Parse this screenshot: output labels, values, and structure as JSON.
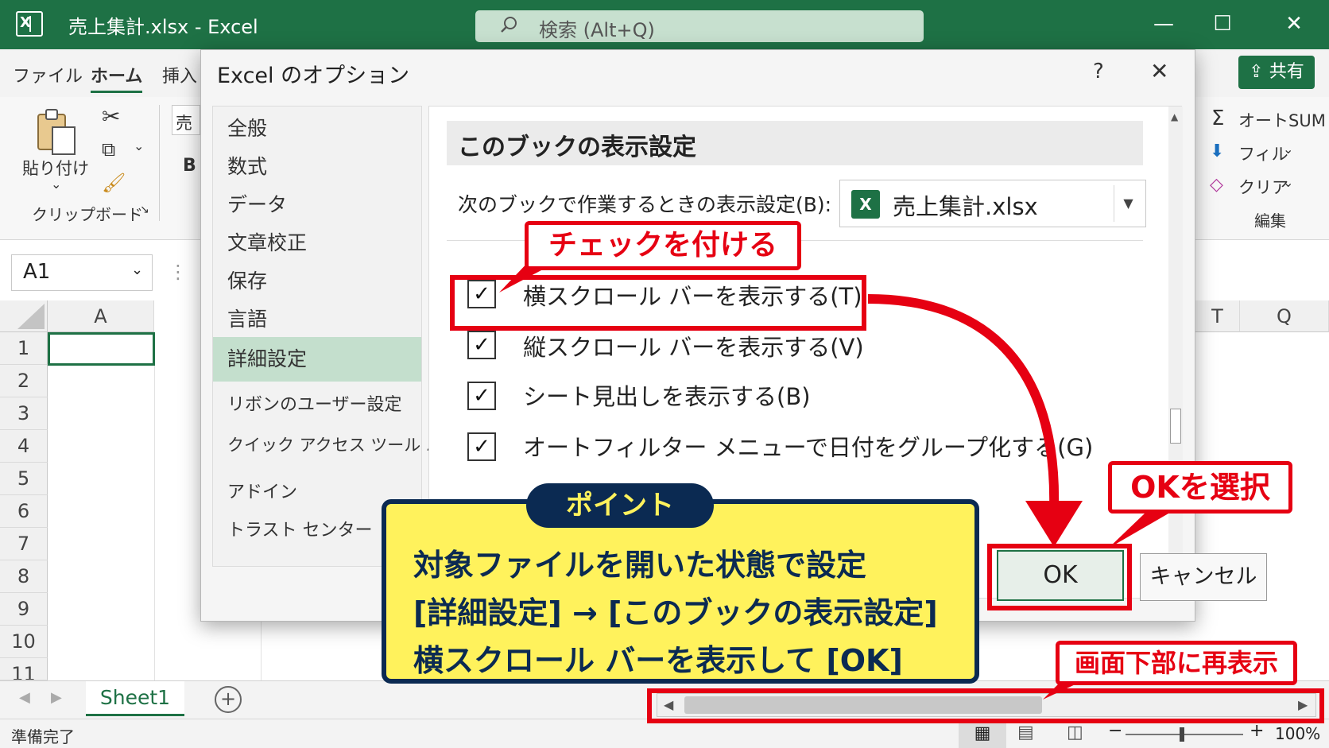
{
  "window": {
    "title": "売上集計.xlsx  -  Excel",
    "search_placeholder": "検索 (Alt+Q)",
    "minimize": "—",
    "maximize": "☐",
    "close": "✕"
  },
  "menu": {
    "tabs": [
      "ファイル",
      "ホーム",
      "挿入"
    ],
    "share": "共有"
  },
  "ribbon": {
    "paste": "貼り付け",
    "clipboard_group": "クリップボード",
    "font_box": "売",
    "bold": "B",
    "autosum": "オートSUM",
    "fill": "フィル",
    "clear": "クリア",
    "edit_group": "編集"
  },
  "formula": {
    "namebox": "A1"
  },
  "grid": {
    "col_a": "A",
    "col_t": "T",
    "col_q": "Q",
    "rows": [
      "1",
      "2",
      "3",
      "4",
      "5",
      "6",
      "7",
      "8",
      "9",
      "10",
      "11"
    ]
  },
  "sheets": {
    "active": "Sheet1",
    "add": "+"
  },
  "status": {
    "ready": "準備完了",
    "zoom": "100%",
    "minus": "−",
    "plus": "+"
  },
  "dialog": {
    "title": "Excel のオプション",
    "help": "?",
    "close": "✕",
    "nav": [
      "全般",
      "数式",
      "データ",
      "文章校正",
      "保存",
      "言語",
      "詳細設定",
      "リボンのユーザー設定",
      "クイック アクセス ツール バー",
      "アドイン",
      "トラスト センター"
    ],
    "selected_nav": "詳細設定",
    "section_header": "このブックの表示設定",
    "book_label": "次のブックで作業するときの表示設定(B):",
    "book_value": "売上集計.xlsx",
    "options": [
      {
        "label": "横スクロール バーを表示する(T)",
        "checked": true
      },
      {
        "label": "縦スクロール バーを表示する(V)",
        "checked": true
      },
      {
        "label": "シート見出しを表示する(B)",
        "checked": true
      },
      {
        "label": "オートフィルター メニューで日付をグループ化する(G)",
        "checked": true
      }
    ],
    "ok": "OK",
    "cancel": "キャンセル"
  },
  "annotations": {
    "check_callout": "チェックを付ける",
    "ok_callout": "OKを選択",
    "redisplay_callout": "画面下部に再表示",
    "point_badge": "ポイント",
    "point_lines": [
      "対象ファイルを開いた状態で設定",
      "[詳細設定] → [このブックの表示設定]",
      "横スクロール バーを表示して [OK]"
    ]
  },
  "colors": {
    "excel_green": "#1e7145",
    "annotation_red": "#e60012",
    "point_yellow": "#fff25c",
    "point_navy": "#0b2a52"
  }
}
